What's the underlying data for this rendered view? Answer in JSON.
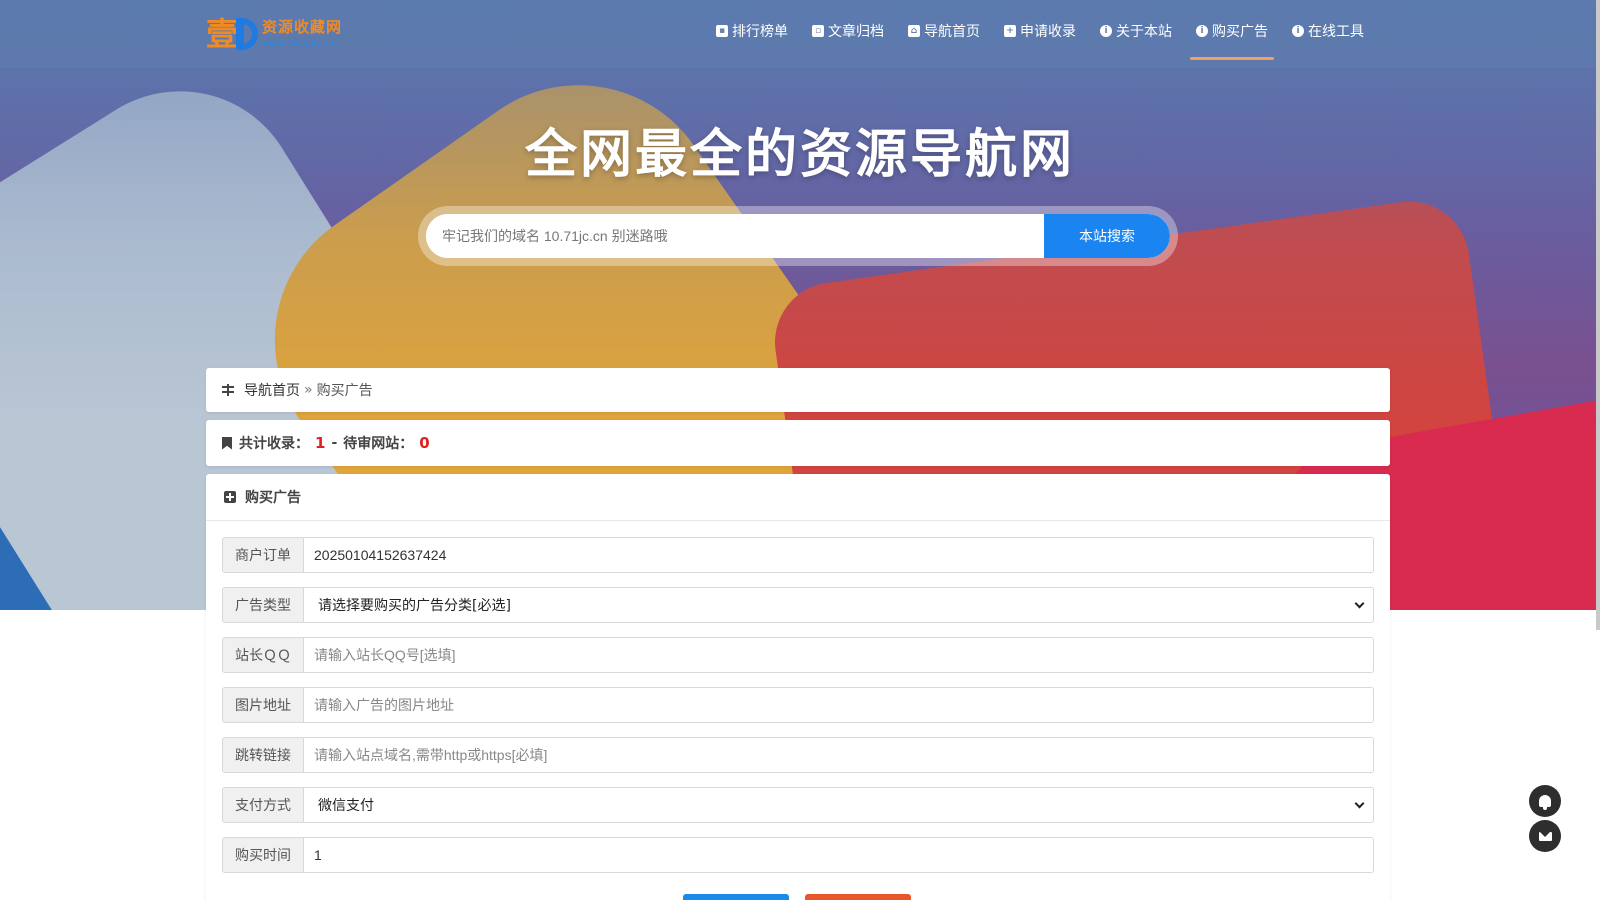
{
  "logo": {
    "glyph": "壹",
    "title": "资源收藏网",
    "url": "www.1dayw.com"
  },
  "nav": {
    "items": [
      {
        "label": "排行榜单",
        "icon": "user-card-icon"
      },
      {
        "label": "文章归档",
        "icon": "archive-icon"
      },
      {
        "label": "导航首页",
        "icon": "home-icon"
      },
      {
        "label": "申请收录",
        "icon": "plus-square-icon"
      },
      {
        "label": "关于本站",
        "icon": "info-icon"
      },
      {
        "label": "购买广告",
        "icon": "info-icon",
        "active": true
      },
      {
        "label": "在线工具",
        "icon": "info-icon"
      }
    ]
  },
  "hero": {
    "title": "全网最全的资源导航网"
  },
  "search": {
    "placeholder": "牢记我们的域名 10.71jc.cn 别迷路哦",
    "button": "本站搜索"
  },
  "breadcrumb": {
    "home": "导航首页",
    "separator": "»",
    "current": "购买广告"
  },
  "stats": {
    "included_label": "共计收录：",
    "included_count": "1",
    "dash": "-",
    "pending_label": "待审网站：",
    "pending_count": "0",
    "count_color": "#e02020"
  },
  "form": {
    "title": "购买广告",
    "fields": {
      "order": {
        "label": "商户订单",
        "value": "20250104152637424"
      },
      "ad_type": {
        "label": "广告类型",
        "value": "请选择要购买的广告分类[必选]"
      },
      "qq": {
        "label": "站长ＱＱ",
        "placeholder": "请输入站长QQ号[选填]"
      },
      "image": {
        "label": "图片地址",
        "placeholder": "请输入广告的图片地址"
      },
      "link": {
        "label": "跳转链接",
        "placeholder": "请输入站点域名,需带http或https[必填]"
      },
      "payment": {
        "label": "支付方式",
        "value": "微信支付"
      },
      "duration": {
        "label": "购买时间",
        "value": "1"
      }
    }
  },
  "floating": {
    "qq_icon": "qq-icon",
    "mail_icon": "mail-icon"
  }
}
